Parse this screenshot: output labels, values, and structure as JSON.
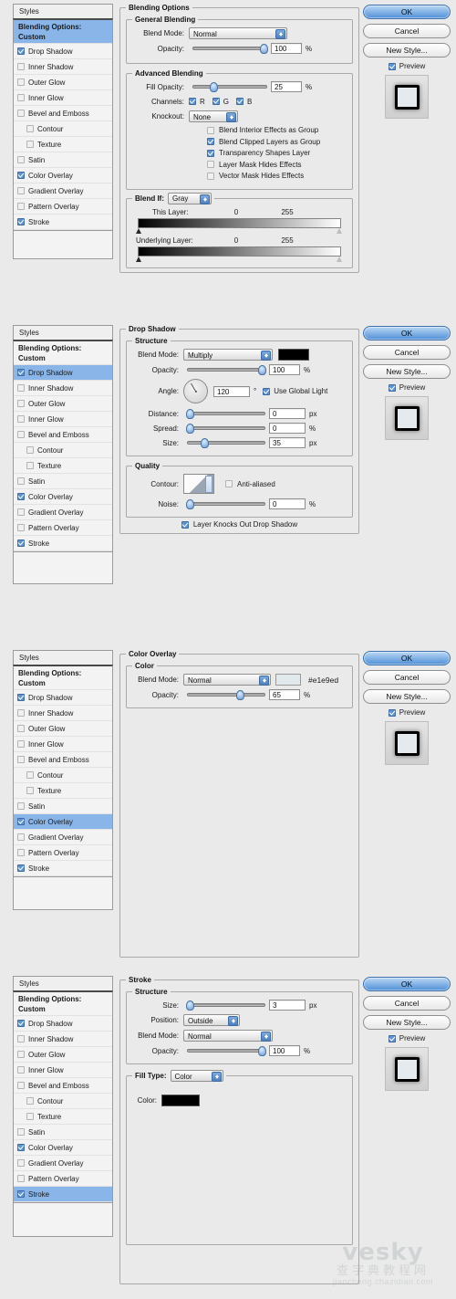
{
  "sidebar": {
    "styles_label": "Styles",
    "blending_options_label": "Blending Options: Custom",
    "items": [
      {
        "label": "Drop Shadow",
        "checked": true
      },
      {
        "label": "Inner Shadow",
        "checked": false
      },
      {
        "label": "Outer Glow",
        "checked": false
      },
      {
        "label": "Inner Glow",
        "checked": false
      },
      {
        "label": "Bevel and Emboss",
        "checked": false
      },
      {
        "label": "Contour",
        "checked": false,
        "sub": true
      },
      {
        "label": "Texture",
        "checked": false,
        "sub": true
      },
      {
        "label": "Satin",
        "checked": false
      },
      {
        "label": "Color Overlay",
        "checked": true
      },
      {
        "label": "Gradient Overlay",
        "checked": false
      },
      {
        "label": "Pattern Overlay",
        "checked": false
      },
      {
        "label": "Stroke",
        "checked": true
      }
    ]
  },
  "buttons": {
    "ok": "OK",
    "cancel": "Cancel",
    "new_style": "New Style...",
    "preview": "Preview",
    "preview_checked": true
  },
  "panel1": {
    "title": "Blending Options",
    "general": {
      "legend": "General Blending",
      "blend_mode_label": "Blend Mode:",
      "blend_mode_value": "Normal",
      "opacity_label": "Opacity:",
      "opacity_value": "100",
      "opacity_unit": "%"
    },
    "advanced": {
      "legend": "Advanced Blending",
      "fill_opacity_label": "Fill Opacity:",
      "fill_opacity_value": "25",
      "fill_opacity_unit": "%",
      "channels_label": "Channels:",
      "channel_r": "R",
      "channel_g": "G",
      "channel_b": "B",
      "knockout_label": "Knockout:",
      "knockout_value": "None",
      "checks": [
        {
          "label": "Blend Interior Effects as Group",
          "checked": false
        },
        {
          "label": "Blend Clipped Layers as Group",
          "checked": true
        },
        {
          "label": "Transparency Shapes Layer",
          "checked": true
        },
        {
          "label": "Layer Mask Hides Effects",
          "checked": false
        },
        {
          "label": "Vector Mask Hides Effects",
          "checked": false
        }
      ]
    },
    "blend_if": {
      "legend_label": "Blend If:",
      "legend_value": "Gray",
      "this_layer_label": "This Layer:",
      "this_layer_min": "0",
      "this_layer_max": "255",
      "underlying_label": "Underlying Layer:",
      "underlying_min": "0",
      "underlying_max": "255"
    }
  },
  "panel2": {
    "title": "Drop Shadow",
    "structure": {
      "legend": "Structure",
      "blend_mode_label": "Blend Mode:",
      "blend_mode_value": "Multiply",
      "color": "#000000",
      "opacity_label": "Opacity:",
      "opacity_value": "100",
      "opacity_unit": "%",
      "angle_label": "Angle:",
      "angle_value": "120",
      "angle_unit": "°",
      "use_global_light": "Use Global Light",
      "use_global_light_checked": true,
      "distance_label": "Distance:",
      "distance_value": "0",
      "distance_unit": "px",
      "spread_label": "Spread:",
      "spread_value": "0",
      "spread_unit": "%",
      "size_label": "Size:",
      "size_value": "35",
      "size_unit": "px"
    },
    "quality": {
      "legend": "Quality",
      "contour_label": "Contour:",
      "anti_aliased": "Anti-aliased",
      "anti_aliased_checked": false,
      "noise_label": "Noise:",
      "noise_value": "0",
      "noise_unit": "%"
    },
    "knocks_out": "Layer Knocks Out Drop Shadow",
    "knocks_out_checked": true
  },
  "panel3": {
    "title": "Color Overlay",
    "color": {
      "legend": "Color",
      "blend_mode_label": "Blend Mode:",
      "blend_mode_value": "Normal",
      "color_swatch": "#e1e9ed",
      "color_hex_label": "#e1e9ed",
      "opacity_label": "Opacity:",
      "opacity_value": "65",
      "opacity_unit": "%"
    }
  },
  "panel4": {
    "title": "Stroke",
    "structure": {
      "legend": "Structure",
      "size_label": "Size:",
      "size_value": "3",
      "size_unit": "px",
      "position_label": "Position:",
      "position_value": "Outside",
      "blend_mode_label": "Blend Mode:",
      "blend_mode_value": "Normal",
      "opacity_label": "Opacity:",
      "opacity_value": "100",
      "opacity_unit": "%"
    },
    "fill": {
      "fill_type_label": "Fill Type:",
      "fill_type_value": "Color",
      "color_label": "Color:",
      "color_swatch": "#000000"
    }
  },
  "watermark": {
    "line1": "vesky",
    "line2": "查字典教程网",
    "line3": "jiaocheng.chazidian.com"
  }
}
